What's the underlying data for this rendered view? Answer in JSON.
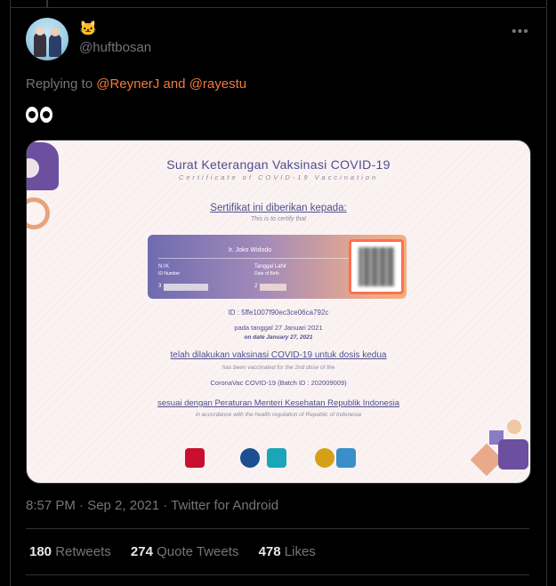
{
  "tweet": {
    "display_name_emoji": "🐱",
    "handle": "@huftbosan",
    "more_icon": "more-horizontal-icon",
    "replying_prefix": "Replying to",
    "reply_mention_1": "@ReynerJ",
    "reply_and": "and",
    "reply_mention_2": "@rayestu",
    "text": "👀",
    "timestamp": "8:57 PM · Sep 2, 2021 · Twitter for Android",
    "retweets_count": "180",
    "retweets_label": "Retweets",
    "quote_count": "274",
    "quote_label": "Quote Tweets",
    "likes_count": "478",
    "likes_label": "Likes"
  },
  "certificate": {
    "title": "Surat Keterangan Vaksinasi COVID-19",
    "subtitle": "Certificate of COVID-19 Vaccination",
    "given_to": "Sertifikat ini diberikan kepada:",
    "certify": "This is to certify that",
    "name": "Ir. Joko Widodo",
    "nik_label": "NIK",
    "nik_sub": "ID Number",
    "nik_value_prefix": "3",
    "dob_label": "Tanggal Lahir",
    "dob_sub": "Date of Birth",
    "dob_value_prefix": "2",
    "id_line": "ID : 5ffe1007f90ec3ce06ca792c",
    "date_id": "pada tanggal 27 Januari 2021",
    "date_en": "on date January 27, 2021",
    "vacc_id": "telah dilakukan vaksinasi COVID-19 untuk dosis kedua",
    "vacc_en": "has been vaccinated for the 2nd dose of the",
    "batch": "CoronaVac COVID-19 (Batch ID : 202009009)",
    "reg_id": "sesuai dengan Peraturan Menteri Kesehatan Republik Indonesia",
    "reg_en": "in accordance with the health regulation of Republic of Indonesia"
  },
  "colors": {
    "accent": "#f4793a",
    "muted": "#71767b",
    "cert_text": "#4d4f8c"
  }
}
